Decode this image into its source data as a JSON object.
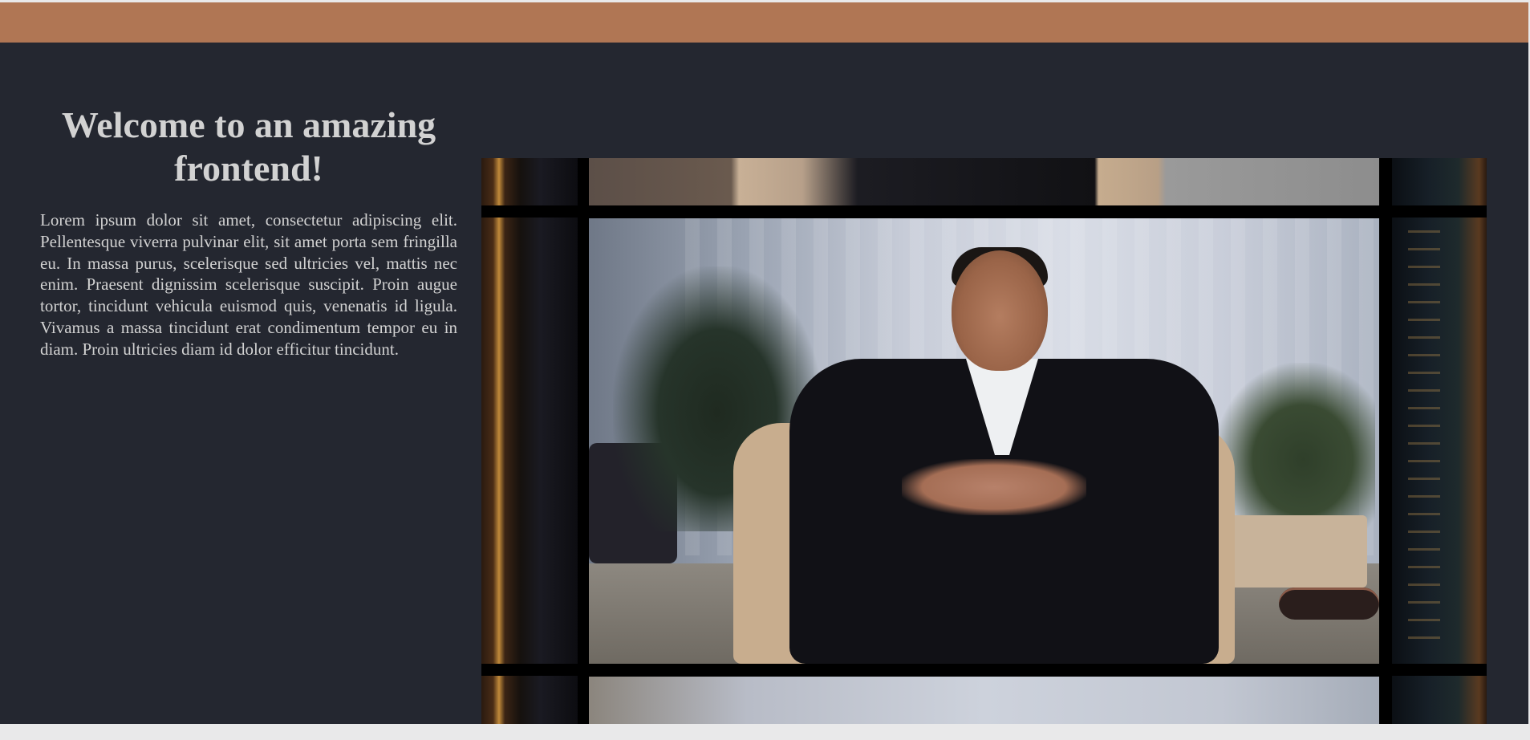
{
  "header": {
    "color": "#b07654"
  },
  "hero": {
    "title": "Welcome to an amazing frontend!",
    "body": "Lorem ipsum dolor sit amet, consectetur adipiscing elit. Pellentesque viverra pulvinar elit, sit amet porta sem fringilla eu. In massa purus, scelerisque sed ultricies vel, mattis nec enim. Praesent dignissim scelerisque suscipit. Proin augue tortor, tincidunt vehicula euismod quis, venenatis id ligula. Vivamus a massa tincidunt erat condimentum tempor eu in diam. Proin ultricies diam id dolor efficitur tincidunt."
  },
  "media": {
    "kind": "video",
    "subject": "man-in-suit-seated-in-armchair"
  },
  "colors": {
    "background": "#242730",
    "text": "#d2d2d2",
    "accent": "#b07654",
    "page_bg": "#e9e9ea"
  }
}
